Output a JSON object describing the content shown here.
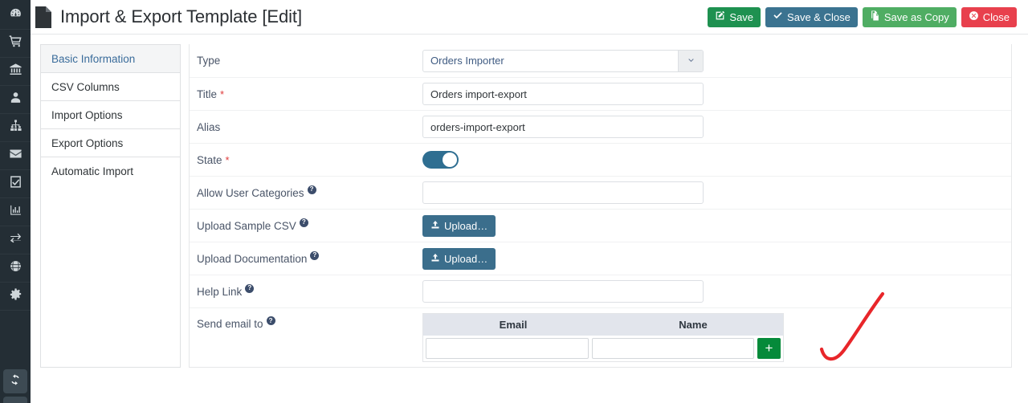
{
  "header": {
    "title": "Import & Export Template [Edit]",
    "doc_icon": "document-icon",
    "buttons": [
      {
        "label": "Save",
        "icon": "edit-square-icon",
        "color": "#1e9150"
      },
      {
        "label": "Save & Close",
        "icon": "check-icon",
        "color": "#3b7390"
      },
      {
        "label": "Save as Copy",
        "icon": "copy-icon",
        "color": "#4fad63"
      },
      {
        "label": "Close",
        "icon": "circle-x-icon",
        "color": "#e8404d"
      }
    ]
  },
  "rail": {
    "items": [
      {
        "icon": "dashboard-gauge-icon"
      },
      {
        "icon": "shopping-cart-icon"
      },
      {
        "icon": "bank-icon"
      },
      {
        "icon": "user-icon"
      },
      {
        "icon": "sitemap-icon"
      },
      {
        "icon": "envelope-icon"
      },
      {
        "icon": "checkbox-checked-icon"
      },
      {
        "icon": "bar-chart-icon"
      },
      {
        "icon": "exchange-arrows-icon"
      },
      {
        "icon": "globe-icon"
      },
      {
        "icon": "gear-icon"
      }
    ],
    "bottom": {
      "icon": "refresh-sync-icon"
    }
  },
  "tabs": [
    {
      "label": "Basic Information",
      "active": true
    },
    {
      "label": "CSV Columns",
      "active": false
    },
    {
      "label": "Import Options",
      "active": false
    },
    {
      "label": "Export Options",
      "active": false
    },
    {
      "label": "Automatic Import",
      "active": false
    }
  ],
  "form": {
    "type": {
      "label": "Type",
      "value": "Orders Importer",
      "arrow_icon": "chevron-down-icon"
    },
    "title": {
      "label": "Title",
      "required": "*",
      "value": "Orders import-export",
      "placeholder": ""
    },
    "alias": {
      "label": "Alias",
      "required": "*",
      "value": "orders-import-export",
      "placeholder": ""
    },
    "state": {
      "label": "State",
      "required": "*",
      "on": true
    },
    "allow_user_categories": {
      "label": "Allow User Categories",
      "help": "?",
      "value": "",
      "placeholder": ""
    },
    "upload_sample_csv": {
      "label": "Upload Sample CSV",
      "help": "?",
      "button": "Upload…",
      "icon": "upload-icon"
    },
    "upload_documentation": {
      "label": "Upload Documentation",
      "help": "?",
      "button": "Upload…",
      "icon": "upload-icon"
    },
    "help_link": {
      "label": "Help Link",
      "help": "?",
      "value": "",
      "placeholder": ""
    },
    "send_email_to": {
      "label": "Send email to",
      "help": "?",
      "columns": [
        "Email",
        "Name"
      ],
      "rows": [
        {
          "email": "",
          "name": ""
        }
      ],
      "add_label": "+"
    }
  },
  "annotation": {
    "type": "red-checkmark-stroke",
    "color": "#e8262a"
  }
}
